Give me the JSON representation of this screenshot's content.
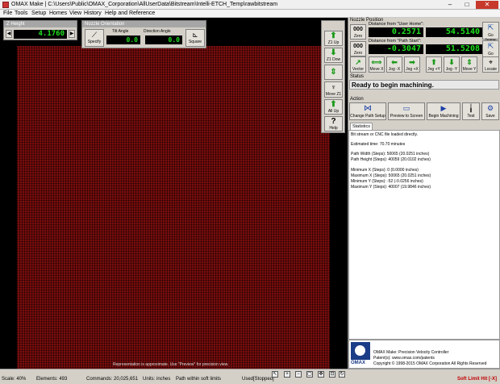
{
  "window": {
    "title": "OMAX Make | C:\\Users\\Public\\OMAX_Corporation\\AllUserData\\Bitstream\\Intelli-ETCH_Temp\\rawbitstream",
    "min": "–",
    "max": "□",
    "close": "✕"
  },
  "menu": [
    "File",
    "Tools",
    "Setup",
    "Homes",
    "View",
    "History",
    "Help and Reference"
  ],
  "zheight": {
    "title": "Z Height",
    "value": "4.1760"
  },
  "nozzle_orientation": {
    "title": "Nozzle Orientation",
    "tilt_label": "Tilt Angle",
    "direction_label": "Direction Angle",
    "tilt_value": "0.0",
    "direction_value": "0.0",
    "specify_label": "Specify",
    "square_label": "Square"
  },
  "zcontrols": {
    "z1_up": "Z1 Up",
    "z1_down": "Z1 Dow",
    "move_z1": "Move Z1",
    "all_up": "All Up",
    "help": "Help"
  },
  "canvas": {
    "note": "Representation is approximate.  Use \"Preview\" for precision view."
  },
  "nozzle_position": {
    "title": "Nozzle Position",
    "from_home_label": "Distance from \"User Home\":",
    "from_start_label": "Distance from \"Path Start\":",
    "x_home": "0.2571",
    "y_home": "54.5140",
    "x_start": "-0.3047",
    "y_start": "51.5208",
    "zero_label": "Zero",
    "zero_digits": "000",
    "go_home_label": "Go home"
  },
  "jog": {
    "vector": "Vector",
    "move_x": "Move X",
    "jog_minus_x": "Jog -X",
    "jog_plus_x": "Jog +X",
    "jog_plus_y": "Jog +Y",
    "jog_minus_y": "Jog -Y",
    "move_y": "Move Y",
    "locate": "Locate"
  },
  "status": {
    "title": "Status",
    "message": "Ready to begin machining."
  },
  "action": {
    "title": "Action",
    "change_path_setup": "Change Path Setup",
    "preview": "Preview to Screen",
    "begin": "Begin Machining",
    "test": "Test",
    "save": "Save"
  },
  "statistics": {
    "tab": "Statistics",
    "lines": [
      "Bit stream or CNC file loaded directly.",
      "",
      "Estimated time: 70.70 minutes",
      "",
      "Path Width (Steps): 50065 (20.0251 inches)",
      "Path Height (Steps): 40059 (20.0102 inches)",
      "",
      "Minimum X (Steps): 0 (0.0000 inches)",
      "Maximum X (Steps): 50065 (20.0251 inches)",
      "Minimum Y (Steps): -52 (-0.0256 inches)",
      "Maximum Y (Steps): 40007 (19.9846 inches)"
    ]
  },
  "about": {
    "line1": "OMAX Make: Precision Velocity Controller",
    "line2": "Patent(s): www.omax.com/patents",
    "line3": "Copyright © 1998-2015 OMAX Corporation All Rights Reserved",
    "logo": "OMAX"
  },
  "statusbar": {
    "scale": "Scale: 40%",
    "elements": "Elements: 493",
    "commands": "Commands: 20,025,651",
    "units": "Units: inches",
    "path": "Path within soft limits",
    "mode": "Used[Stopped]",
    "soft_limit": "Soft Limit Hit [-X]"
  },
  "colors": {
    "digits": "#1fe11f",
    "path_red": "#7a0d0d",
    "soft_limit": "#c00000"
  }
}
